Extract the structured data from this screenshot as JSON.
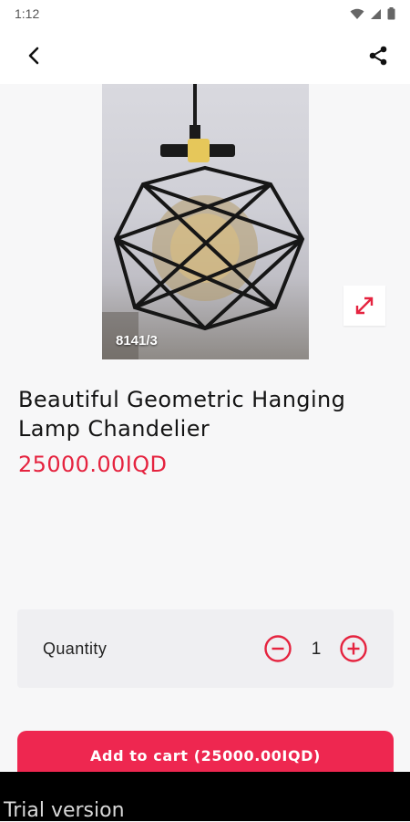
{
  "statusbar": {
    "time": "1:12"
  },
  "product": {
    "image_counter": "8141/3",
    "title": "Beautiful Geometric Hanging Lamp Chandelier",
    "price": "25000.00IQD"
  },
  "quantity": {
    "label": "Quantity",
    "value": "1"
  },
  "cart": {
    "button_label": "Add to cart (25000.00IQD)"
  },
  "trial": {
    "label": "Trial version"
  },
  "colors": {
    "accent": "#e5233f",
    "button": "#ee2750"
  },
  "icons": [
    "back-arrow-icon",
    "share-icon",
    "expand-icon",
    "minus-circle-icon",
    "plus-circle-icon",
    "wifi-icon",
    "signal-icon",
    "battery-icon"
  ]
}
